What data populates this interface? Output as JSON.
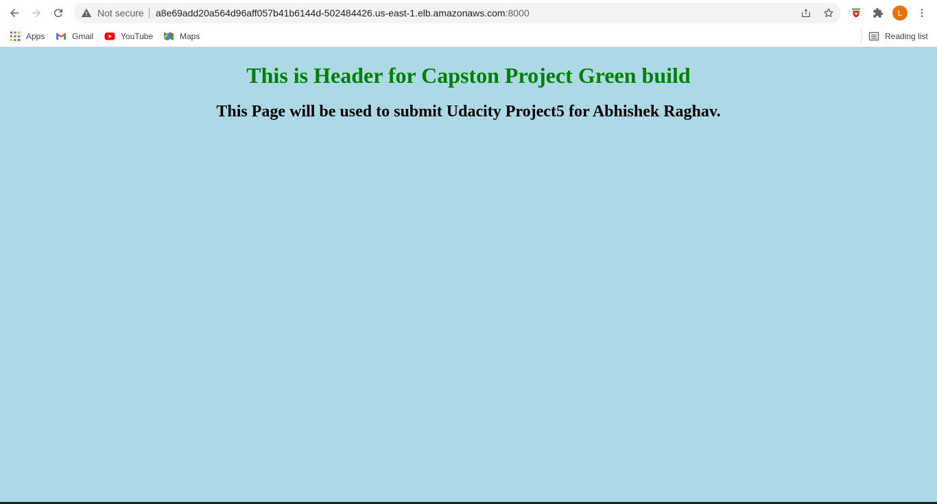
{
  "browser": {
    "security_label": "Not secure",
    "url_host": "a8e69add20a564d96aff057b41b6144d-502484426.us-east-1.elb.amazonaws.com",
    "url_port": ":8000",
    "profile_initial": "L",
    "profile_color": "#e8710a"
  },
  "bookmarks": {
    "items": [
      {
        "label": "Apps",
        "icon": "apps-grid-icon"
      },
      {
        "label": "Gmail",
        "icon": "gmail-icon"
      },
      {
        "label": "YouTube",
        "icon": "youtube-icon"
      },
      {
        "label": "Maps",
        "icon": "maps-icon"
      }
    ],
    "reading_list": "Reading list"
  },
  "page": {
    "background": "#add8e6",
    "header": "This is Header for Capston Project Green build",
    "header_color": "#008000",
    "subheader": "This Page will be used to submit Udacity Project5 for Abhishek Raghav."
  }
}
